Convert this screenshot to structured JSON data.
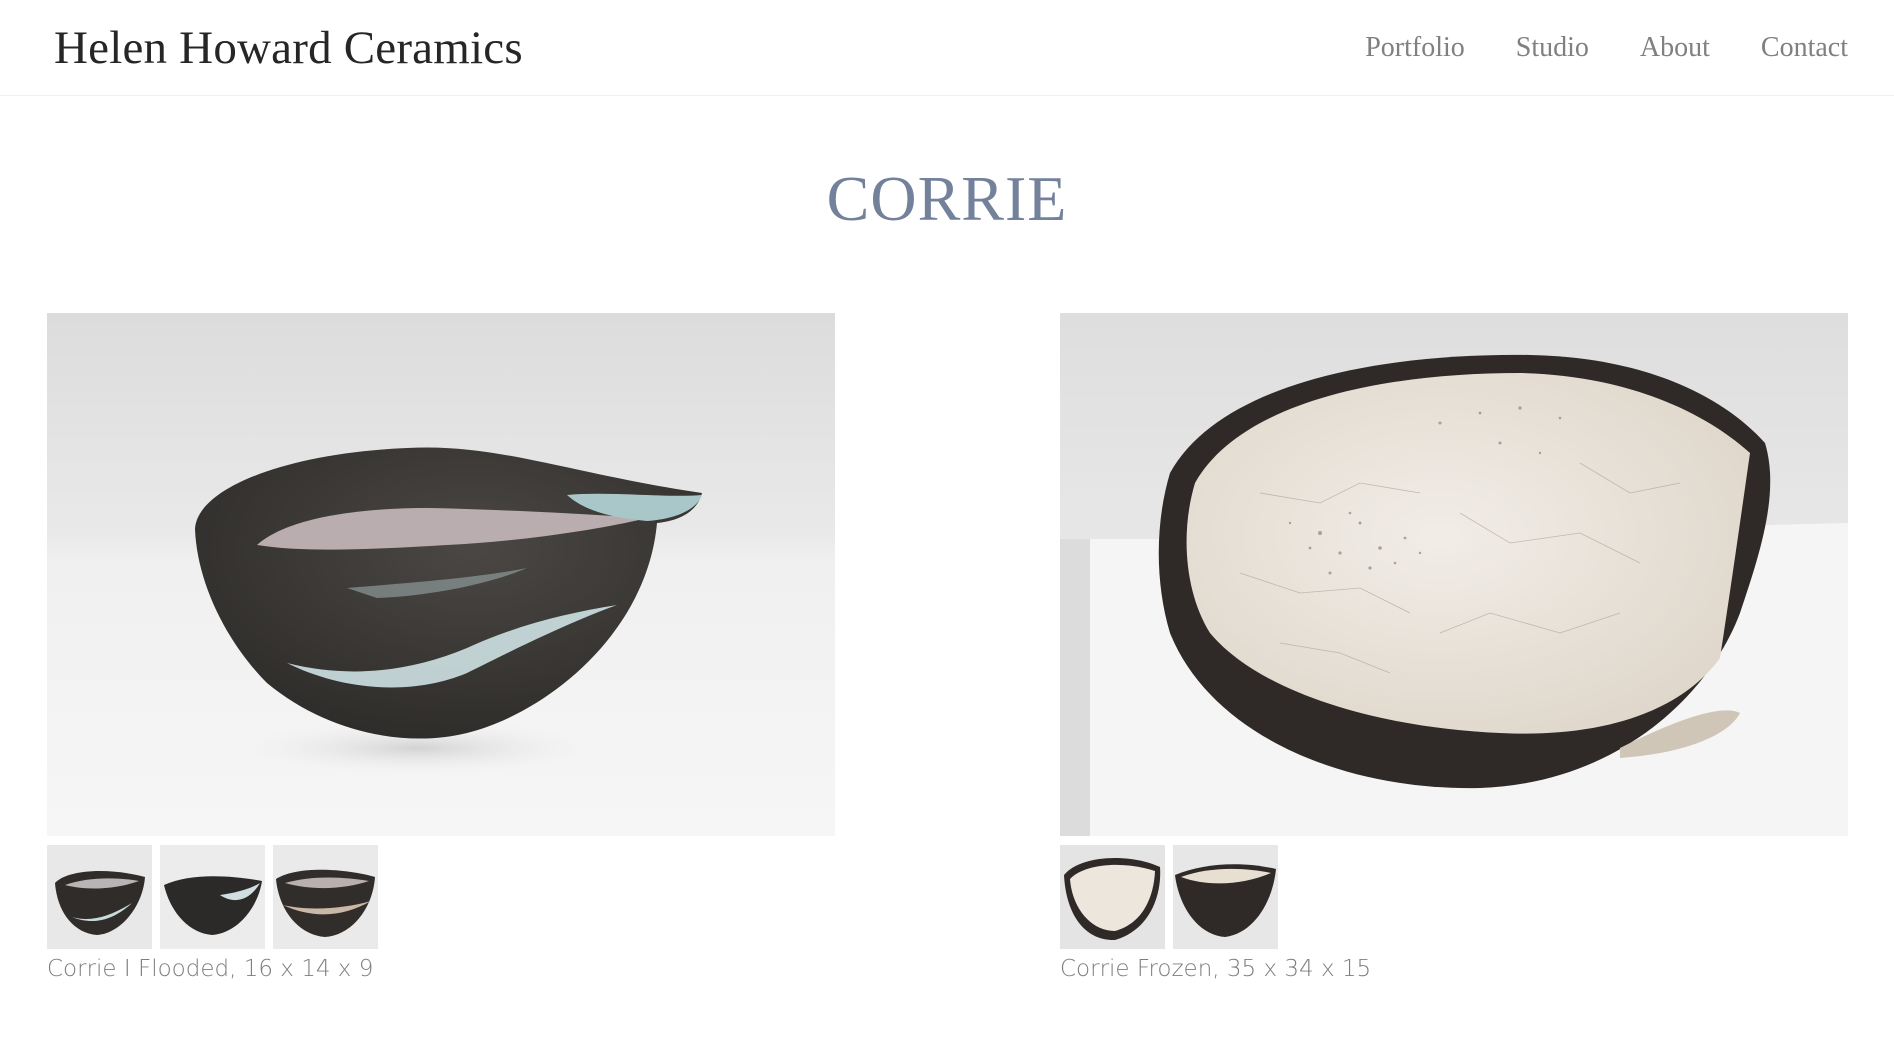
{
  "header": {
    "logo": "Helen Howard Ceramics",
    "nav": [
      "Portfolio",
      "Studio",
      "About",
      "Contact"
    ]
  },
  "page": {
    "title": "CORRIE"
  },
  "galleries": [
    {
      "caption": "Corrie I Flooded, 16 x 14 x 9",
      "thumb_count": 3
    },
    {
      "caption": "Corrie Frozen, 35 x 34 x 15",
      "thumb_count": 2
    }
  ],
  "colors": {
    "title": "#73819b",
    "nav": "#808080",
    "caption": "#7d7d7d",
    "logo": "#262626"
  }
}
